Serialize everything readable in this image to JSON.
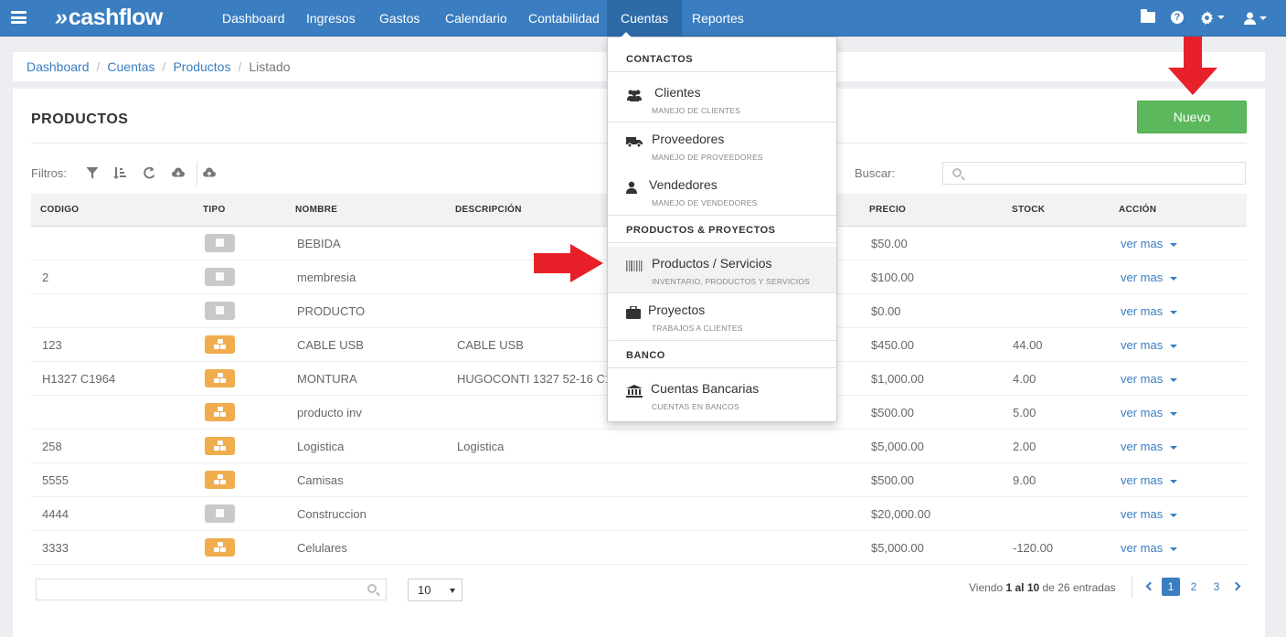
{
  "app": {
    "logo": "cashflow"
  },
  "nav": [
    {
      "label": "Dashboard"
    },
    {
      "label": "Ingresos"
    },
    {
      "label": "Gastos"
    },
    {
      "label": "Calendario"
    },
    {
      "label": "Contabilidad"
    },
    {
      "label": "Cuentas"
    },
    {
      "label": "Reportes"
    }
  ],
  "breadcrumb": {
    "items": [
      "Dashboard",
      "Cuentas",
      "Productos"
    ],
    "current": "Listado"
  },
  "panel": {
    "title": "PRODUCTOS",
    "new_button": "Nuevo"
  },
  "filters": {
    "label": "Filtros:",
    "search_label": "Buscar:"
  },
  "table": {
    "columns": [
      "CODIGO",
      "TIPO",
      "NOMBRE",
      "DESCRIPCIÓN",
      "PRECIO",
      "STOCK",
      "ACCIÓN"
    ],
    "action_label": "ver mas",
    "rows": [
      {
        "codigo": "",
        "tipo": "grey",
        "nombre": "BEBIDA",
        "descripcion": "",
        "precio": "$50.00",
        "stock": ""
      },
      {
        "codigo": "2",
        "tipo": "grey",
        "nombre": "membresia",
        "descripcion": "",
        "precio": "$100.00",
        "stock": ""
      },
      {
        "codigo": "",
        "tipo": "grey",
        "nombre": "PRODUCTO",
        "descripcion": "",
        "precio": "$0.00",
        "stock": ""
      },
      {
        "codigo": "123",
        "tipo": "orange",
        "nombre": "CABLE USB",
        "descripcion": "CABLE USB",
        "precio": "$450.00",
        "stock": "44.00"
      },
      {
        "codigo": "H1327 C1964",
        "tipo": "orange",
        "nombre": "MONTURA",
        "descripcion": "HUGOCONTI 1327 52-16 C1",
        "precio": "$1,000.00",
        "stock": "4.00"
      },
      {
        "codigo": "",
        "tipo": "orange",
        "nombre": "producto inv",
        "descripcion": "",
        "precio": "$500.00",
        "stock": "5.00"
      },
      {
        "codigo": "258",
        "tipo": "orange",
        "nombre": "Logistica",
        "descripcion": "Logistica",
        "precio": "$5,000.00",
        "stock": "2.00"
      },
      {
        "codigo": "5555",
        "tipo": "orange",
        "nombre": "Camisas",
        "descripcion": "",
        "precio": "$500.00",
        "stock": "9.00"
      },
      {
        "codigo": "4444",
        "tipo": "grey",
        "nombre": "Construccion",
        "descripcion": "",
        "precio": "$20,000.00",
        "stock": ""
      },
      {
        "codigo": "3333",
        "tipo": "orange",
        "nombre": "Celulares",
        "descripcion": "",
        "precio": "$5,000.00",
        "stock": "-120.00"
      }
    ]
  },
  "footer": {
    "page_size": "10",
    "entries_prefix": "Viendo",
    "entries_from_to": "1 al 10",
    "entries_of": "de",
    "entries_total": "26",
    "entries_suffix": "entradas",
    "pages": [
      "1",
      "2",
      "3"
    ]
  },
  "dropdown": {
    "sections": [
      {
        "header": "CONTACTOS",
        "items": [
          {
            "title": "Clientes",
            "subtitle": "MANEJO DE CLIENTES",
            "icon": "users-icon"
          },
          {
            "title": "Proveedores",
            "subtitle": "MANEJO DE PROVEEDORES",
            "icon": "truck-icon"
          },
          {
            "title": "Vendedores",
            "subtitle": "MANEJO DE VENDEDORES",
            "icon": "user-icon"
          }
        ]
      },
      {
        "header": "PRODUCTOS & PROYECTOS",
        "items": [
          {
            "title": "Productos / Servicios",
            "subtitle": "INVENTARIO, PRODUCTOS Y SERVICIOS",
            "icon": "barcode-icon"
          },
          {
            "title": "Proyectos",
            "subtitle": "TRABAJOS A CLIENTES",
            "icon": "briefcase-icon"
          }
        ]
      },
      {
        "header": "BANCO",
        "items": [
          {
            "title": "Cuentas Bancarias",
            "subtitle": "CUENTAS EN BANCOS",
            "icon": "bank-icon"
          }
        ]
      }
    ]
  },
  "colors": {
    "navbar": "#3a7dc0",
    "success": "#5cb85c",
    "warning": "#f0ad4e",
    "arrow": "#e8202a"
  }
}
